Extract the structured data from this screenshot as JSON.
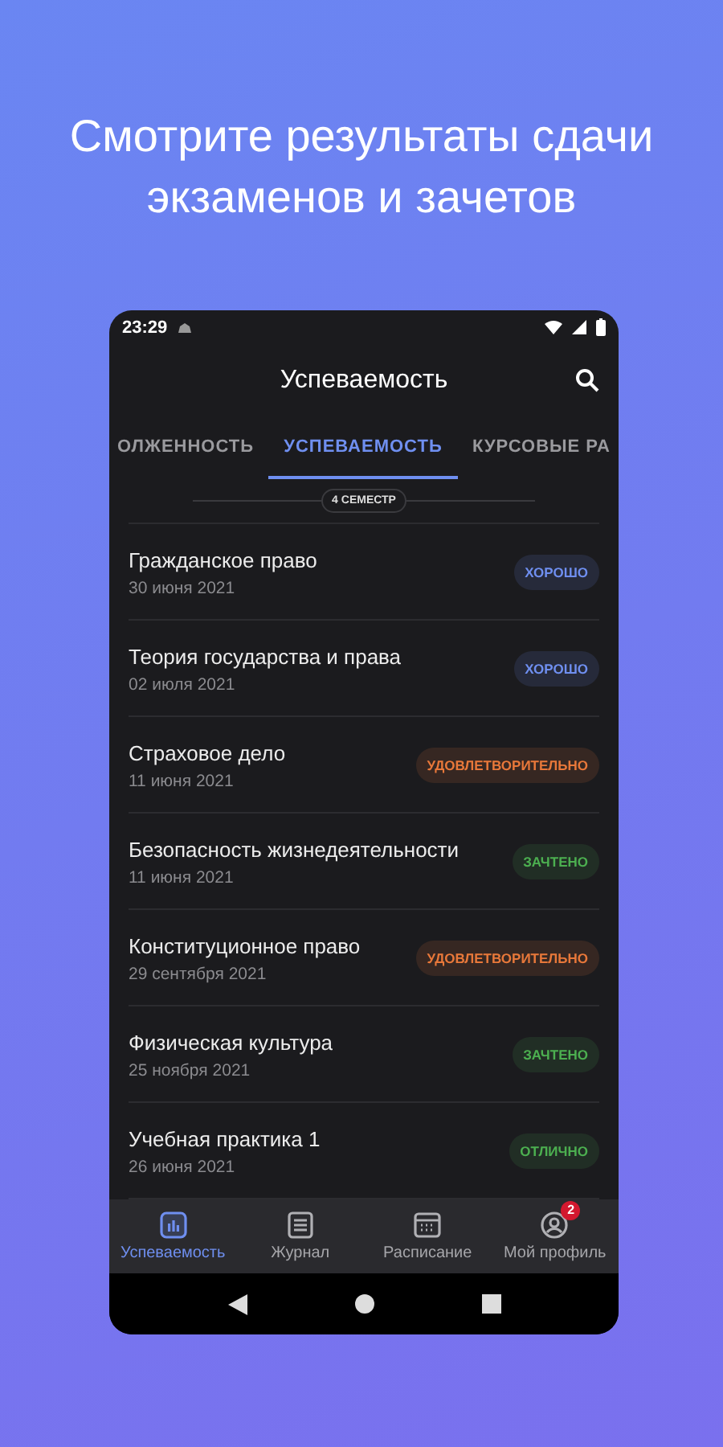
{
  "headline": "Смотрите результаты сдачи экзаменов и зачетов",
  "status_bar": {
    "time": "23:29"
  },
  "app_bar": {
    "title": "Успеваемость"
  },
  "tabs": [
    {
      "label": "ОЛЖЕННОСТЬ",
      "selected": false
    },
    {
      "label": "УСПЕВАЕМОСТЬ",
      "selected": true
    },
    {
      "label": "КУРСОВЫЕ РА",
      "selected": false
    }
  ],
  "semester": "4 СЕМЕСТР",
  "grades": [
    {
      "subject": "Гражданское право",
      "date": "30 июня 2021",
      "grade": "ХОРОШО",
      "color": "#6f8ff0"
    },
    {
      "subject": "Теория государства и права",
      "date": "02 июля 2021",
      "grade": "ХОРОШО",
      "color": "#6f8ff0"
    },
    {
      "subject": "Страховое дело",
      "date": "11 июня 2021",
      "grade": "УДОВЛЕТВОРИТЕЛЬНО",
      "color": "#e8783a"
    },
    {
      "subject": "Безопасность жизнедеятельности",
      "date": "11 июня 2021",
      "grade": "ЗАЧТЕНО",
      "color": "#4caf50"
    },
    {
      "subject": "Конституционное право",
      "date": "29 сентября 2021",
      "grade": "УДОВЛЕТВОРИТЕЛЬНО",
      "color": "#e8783a"
    },
    {
      "subject": "Физическая культура",
      "date": "25 ноября 2021",
      "grade": "ЗАЧТЕНО",
      "color": "#4caf50"
    },
    {
      "subject": "Учебная практика 1",
      "date": "26 июня 2021",
      "grade": "ОТЛИЧНО",
      "color": "#4caf50"
    }
  ],
  "bottom_nav": [
    {
      "kind": "chart",
      "label": "Успеваемость",
      "selected": true
    },
    {
      "kind": "journal",
      "label": "Журнал",
      "selected": false
    },
    {
      "kind": "calendar",
      "label": "Расписание",
      "selected": false
    },
    {
      "kind": "profile",
      "label": "Мой профиль",
      "selected": false,
      "badge": "2"
    }
  ]
}
